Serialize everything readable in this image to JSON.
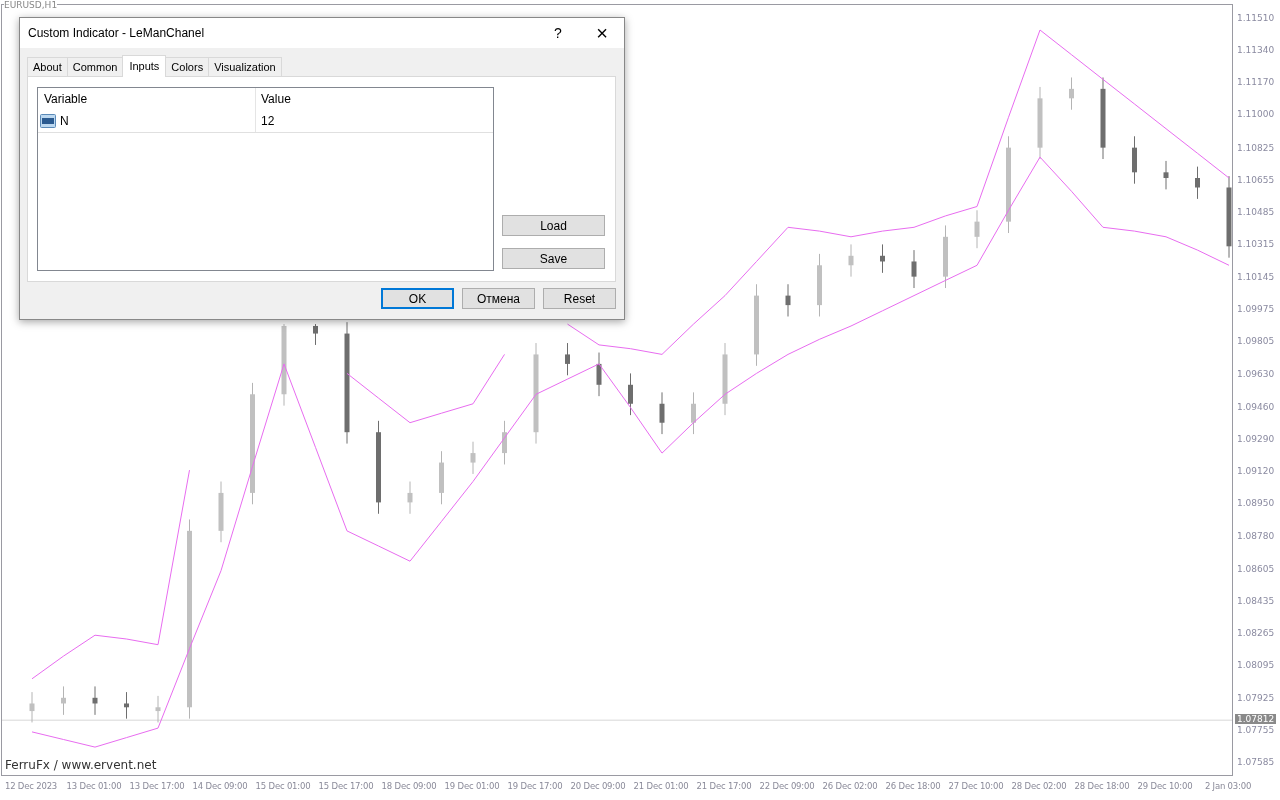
{
  "chart": {
    "symbol_label": "EURUSD,H1",
    "chart_data": {
      "type": "candlestick",
      "categories": [
        "12 Dec 2023",
        null,
        "13 Dec 01:00",
        null,
        "13 Dec 17:00",
        null,
        "14 Dec 09:00",
        null,
        "15 Dec 01:00",
        null,
        "15 Dec 17:00",
        null,
        "18 Dec 09:00",
        null,
        "19 Dec 01:00",
        null,
        "19 Dec 17:00",
        null,
        "20 Dec 09:00",
        null,
        "21 Dec 01:00",
        null,
        "21 Dec 17:00",
        null,
        "22 Dec 09:00",
        null,
        "26 Dec 02:00",
        null,
        "26 Dec 18:00",
        null,
        "27 Dec 10:00",
        null,
        "28 Dec 02:00",
        null,
        "28 Dec 18:00",
        null,
        "29 Dec 10:00",
        null,
        "2 Jan 03:00"
      ],
      "ohlc": [
        [
          1.0786,
          1.0796,
          1.078,
          1.079
        ],
        [
          1.079,
          1.0799,
          1.0784,
          1.0793
        ],
        [
          1.0793,
          1.0799,
          1.0784,
          1.079
        ],
        [
          1.079,
          1.0796,
          1.0782,
          1.0788
        ],
        [
          1.0786,
          1.0794,
          1.078,
          1.0788
        ],
        [
          1.0788,
          1.0887,
          1.0782,
          1.0881
        ],
        [
          1.0881,
          1.0907,
          1.0875,
          1.0901
        ],
        [
          1.0901,
          1.0959,
          1.0895,
          1.0953
        ],
        [
          1.0953,
          1.099,
          1.0947,
          1.0989
        ],
        [
          1.0989,
          1.099,
          1.0979,
          1.0985
        ],
        [
          1.0985,
          1.0991,
          1.0927,
          1.0933
        ],
        [
          1.0933,
          1.0939,
          1.089,
          1.0896
        ],
        [
          1.0896,
          1.0907,
          1.089,
          1.0901
        ],
        [
          1.0901,
          1.0923,
          1.0895,
          1.0917
        ],
        [
          1.0917,
          1.0928,
          1.0911,
          1.0922
        ],
        [
          1.0922,
          1.0939,
          1.0916,
          1.0933
        ],
        [
          1.0933,
          1.098,
          1.0927,
          1.0974
        ],
        [
          1.0974,
          1.098,
          1.0963,
          1.0969
        ],
        [
          1.0969,
          1.0975,
          1.0952,
          1.0958
        ],
        [
          1.0958,
          1.0964,
          1.0942,
          1.0948
        ],
        [
          1.0948,
          1.0954,
          1.0932,
          1.0938
        ],
        [
          1.0938,
          1.0954,
          1.0932,
          1.0948
        ],
        [
          1.0948,
          1.098,
          1.0942,
          1.0974
        ],
        [
          1.0974,
          1.1011,
          1.0968,
          1.1005
        ],
        [
          1.1005,
          1.1011,
          1.0994,
          1.1
        ],
        [
          1.1,
          1.1027,
          1.0994,
          1.1021
        ],
        [
          1.1021,
          1.1032,
          1.1015,
          1.1026
        ],
        [
          1.1026,
          1.1032,
          1.1017,
          1.1023
        ],
        [
          1.1023,
          1.1029,
          1.1009,
          1.1015
        ],
        [
          1.1015,
          1.1042,
          1.1009,
          1.1036
        ],
        [
          1.1036,
          1.105,
          1.103,
          1.1044
        ],
        [
          1.1044,
          1.1089,
          1.1038,
          1.1083
        ],
        [
          1.1083,
          1.1115,
          1.1077,
          1.1109
        ],
        [
          1.1109,
          1.112,
          1.1103,
          1.1114
        ],
        [
          1.1114,
          1.112,
          1.1077,
          1.1083
        ],
        [
          1.1083,
          1.1089,
          1.1064,
          1.107
        ],
        [
          1.107,
          1.1076,
          1.1061,
          1.1067
        ],
        [
          1.1067,
          1.1073,
          1.1056,
          1.1062
        ],
        [
          1.1062,
          1.1068,
          1.1025,
          1.1031
        ]
      ],
      "series": [
        {
          "type": "line",
          "color": "#e86cf0",
          "values": [
            1.0803,
            1.0815,
            1.0826,
            1.0824,
            1.0821,
            1.0913,
            null,
            null,
            null,
            null,
            1.0964,
            1.0951,
            1.0938,
            1.0943,
            1.0948,
            1.0974,
            null,
            1.099,
            1.0979,
            1.0977,
            1.0974,
            1.099,
            1.1005,
            1.1023,
            1.1041,
            1.1039,
            1.1036,
            1.1039,
            1.1041,
            1.1047,
            1.1052,
            1.1099,
            1.1145,
            1.1132,
            1.1119,
            1.1106,
            1.1093,
            1.108,
            1.1067
          ]
        },
        {
          "type": "line",
          "color": "#e86cf0",
          "values": [
            1.0775,
            1.0771,
            1.0767,
            1.0772,
            1.0777,
            1.0819,
            1.086,
            1.0915,
            1.0969,
            1.0925,
            1.0881,
            1.0873,
            1.0865,
            1.0886,
            1.0907,
            1.093,
            1.0953,
            1.0961,
            1.0969,
            1.0946,
            1.0922,
            1.0938,
            1.0953,
            1.0964,
            1.0974,
            1.0982,
            1.0989,
            1.0997,
            1.1005,
            1.1013,
            1.1021,
            1.105,
            1.1078,
            1.106,
            1.1041,
            1.1039,
            1.1036,
            1.1029,
            1.1021
          ]
        }
      ],
      "ref_lines": [
        {
          "axis": "y",
          "value": 1.07812,
          "label": "1.07812",
          "color": "#d8d8d8"
        }
      ],
      "ylim": [
        1.07523,
        1.11582
      ],
      "yticks": [
        {
          "value": 1.1151,
          "label": "1.11510"
        },
        {
          "value": 1.1134,
          "label": "1.11340"
        },
        {
          "value": 1.1117,
          "label": "1.11170"
        },
        {
          "value": 1.11,
          "label": "1.11000"
        },
        {
          "value": 1.10825,
          "label": "1.10825"
        },
        {
          "value": 1.10655,
          "label": "1.10655"
        },
        {
          "value": 1.10485,
          "label": "1.10485"
        },
        {
          "value": 1.10315,
          "label": "1.10315"
        },
        {
          "value": 1.10145,
          "label": "1.10145"
        },
        {
          "value": 1.09975,
          "label": "1.09975"
        },
        {
          "value": 1.09805,
          "label": "1.09805"
        },
        {
          "value": 1.0963,
          "label": "1.09630"
        },
        {
          "value": 1.0946,
          "label": "1.09460"
        },
        {
          "value": 1.0929,
          "label": "1.09290"
        },
        {
          "value": 1.0912,
          "label": "1.09120"
        },
        {
          "value": 1.0895,
          "label": "1.08950"
        },
        {
          "value": 1.0878,
          "label": "1.08780"
        },
        {
          "value": 1.08605,
          "label": "1.08605"
        },
        {
          "value": 1.08435,
          "label": "1.08435"
        },
        {
          "value": 1.08265,
          "label": "1.08265"
        },
        {
          "value": 1.08095,
          "label": "1.08095"
        },
        {
          "value": 1.07925,
          "label": "1.07925"
        },
        {
          "value": 1.07755,
          "label": "1.07755"
        },
        {
          "value": 1.07585,
          "label": "1.07585"
        }
      ]
    },
    "footer_label": "FerruFx / www.ervent.net"
  },
  "dialog": {
    "title": "Custom Indicator - LeManChanel",
    "help": "?",
    "close": "×",
    "tabs": [
      {
        "label": "About",
        "selected": false
      },
      {
        "label": "Common",
        "selected": false
      },
      {
        "label": "Inputs",
        "selected": true
      },
      {
        "label": "Colors",
        "selected": false
      },
      {
        "label": "Visualization",
        "selected": false
      }
    ],
    "table": {
      "columns": [
        "Variable",
        "Value"
      ],
      "rows": [
        {
          "variable": "N",
          "value": "12"
        }
      ]
    },
    "side_buttons": [
      "Load",
      "Save"
    ],
    "buttons": [
      {
        "label": "OK",
        "default": true
      },
      {
        "label": "Отмена",
        "default": false
      },
      {
        "label": "Reset",
        "default": false
      }
    ]
  }
}
